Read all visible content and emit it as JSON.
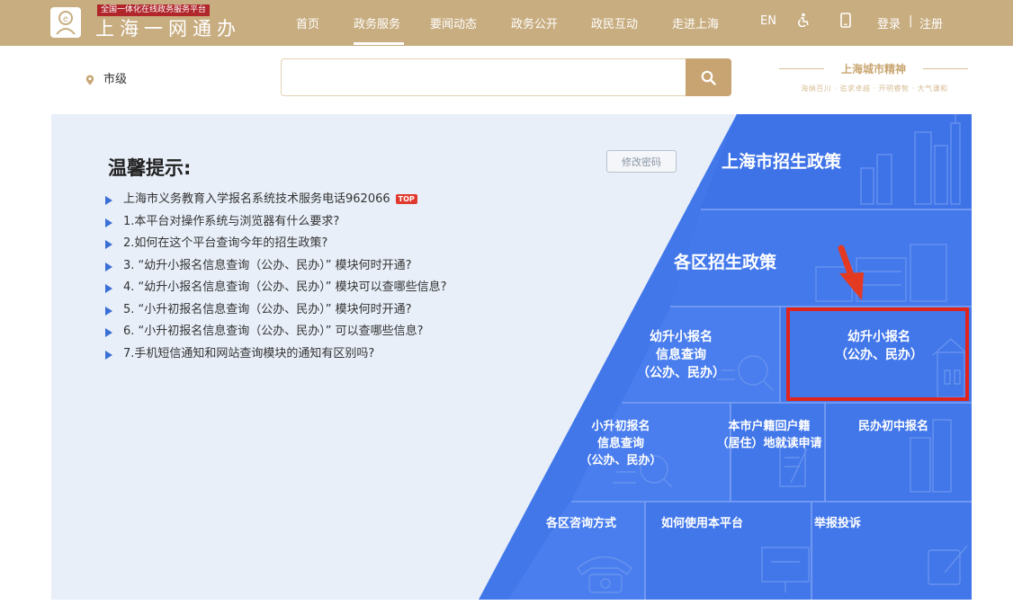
{
  "header": {
    "logo_tag": "全国一体化在线政务服务平台",
    "logo_name": "上海一网通办",
    "nav": [
      "首页",
      "政务服务",
      "要闻动态",
      "政务公开",
      "政民互动",
      "走进上海"
    ],
    "lang": "EN",
    "login": "登录",
    "separator": "|",
    "register": "注册"
  },
  "search": {
    "location": "市级",
    "placeholder": "",
    "spirit_title": "上海城市精神",
    "spirit_sub": "海纳百川 · 追求卓越 · 开明睿智 · 大气谦和"
  },
  "tips": {
    "title": "温馨提示:",
    "change_password": "修改密码",
    "items": [
      "上海市义务教育入学报名系统技术服务电话962066",
      "1.本平台对操作系统与浏览器有什么要求?",
      "2.如何在这个平台查询今年的招生政策?",
      "3. “幼升小报名信息查询（公办、民办）” 模块何时开通?",
      "4. “幼升小报名信息查询（公办、民办）” 模块可以查哪些信息?",
      "5. “小升初报名信息查询（公办、民办）” 模块何时开通?",
      "6. “小升初报名信息查询（公办、民办）” 可以查哪些信息?",
      "7.手机短信通知和网站查询模块的通知有区别吗?"
    ],
    "top_badge": "TOP"
  },
  "tiles": {
    "sh_policy": "上海市招生政策",
    "district_policy": "各区招生政策",
    "primary_query": [
      "幼升小报名",
      "信息查询",
      "（公办、民办）"
    ],
    "primary_signup": [
      "幼升小报名",
      "（公办、民办）"
    ],
    "middle_query": [
      "小升初报名",
      "信息查询",
      "（公办、民办）"
    ],
    "hukou_apply": [
      "本市户籍回户籍",
      "（居住）地就读申请"
    ],
    "private_middle": "民办初中报名",
    "contact": "各区咨询方式",
    "howto": "如何使用本平台",
    "report": "举报投诉"
  },
  "colors": {
    "header_bg": "#c8ad80",
    "tile_blue": "#3f73e8",
    "highlight_red": "#e0241b"
  }
}
